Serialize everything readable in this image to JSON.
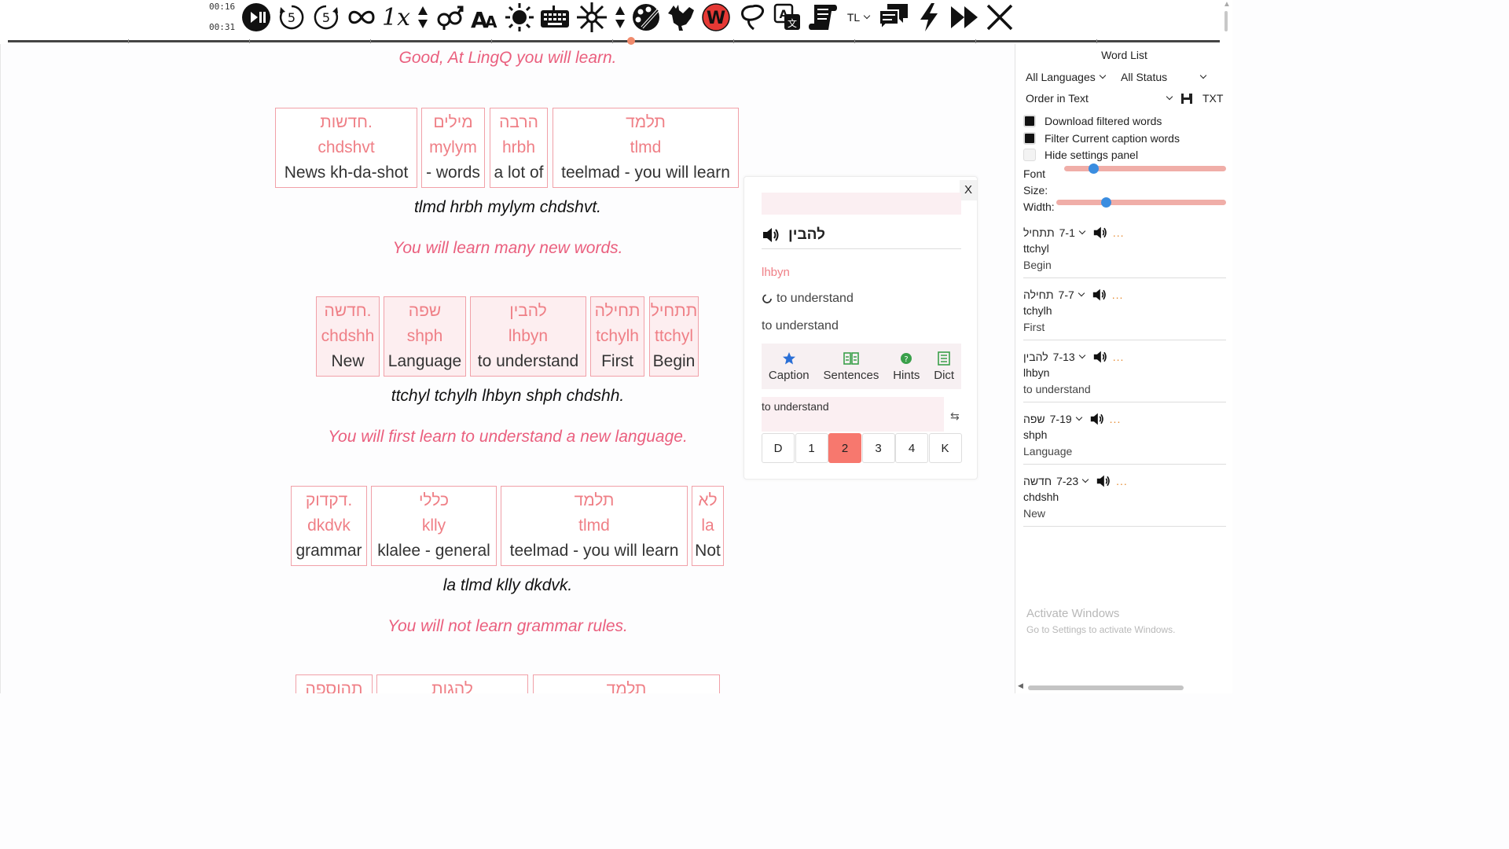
{
  "player": {
    "time_current": "00:16",
    "time_total": "00:31",
    "speed_label": "1x",
    "lang_label": "TL"
  },
  "icons": {
    "play_pause": "play-pause-icon",
    "rewind5": "rewind-5-icon",
    "forward5": "forward-5-icon",
    "loop": "loop-infinity-icon",
    "speed": "speed-icon",
    "gender": "gender-icon",
    "font": "font-size-icon",
    "brightness": "sun-icon",
    "keyboard": "keyboard-icon",
    "spark": "spark-icon",
    "palette": "palette-icon",
    "rooster": "rooster-icon",
    "word": "w-icon",
    "lasso": "lasso-icon",
    "translate": "translate-icon",
    "scroll": "scroll-icon",
    "comments": "comments-icon",
    "bolt": "bolt-icon",
    "fast_forward": "fast-forward-icon",
    "close": "close-icon"
  },
  "colors": {
    "accent_pink": "#ea5f7e",
    "card_border": "#f1a0a8",
    "active_level": "#f7786e",
    "slider_knob": "#3a8de0",
    "w_icon_bg": "#e53935"
  },
  "reader": {
    "sentences": [
      {
        "translation_top": "Good, At LingQ you will learn.",
        "cards": [
          {
            "heb": "חדשות.",
            "lat": "chdshvt",
            "eng": "News kh-da-shot"
          },
          {
            "heb": "מילים",
            "lat": "mylym",
            "eng": "- words"
          },
          {
            "heb": "הרבה",
            "lat": "hrbh",
            "eng": "a lot of"
          },
          {
            "heb": "תלמד",
            "lat": "tlmd",
            "eng": "teelmad - you will learn"
          }
        ],
        "translit": "tlmd hrbh mylym chdshvt.",
        "translation": "You will learn many new words."
      },
      {
        "cards": [
          {
            "heb": "חדשה.",
            "lat": "chdshh",
            "eng": "New"
          },
          {
            "heb": "שפה",
            "lat": "shph",
            "eng": "Language"
          },
          {
            "heb": "להבין",
            "lat": "lhbyn",
            "eng": "to understand"
          },
          {
            "heb": "תחילה",
            "lat": "tchylh",
            "eng": "First"
          },
          {
            "heb": "תתחיל",
            "lat": "ttchyl",
            "eng": "Begin"
          }
        ],
        "translit": "ttchyl tchylh lhbyn shph chdshh.",
        "translation": "You will first learn to understand a new language."
      },
      {
        "cards": [
          {
            "heb": "דקדוק.",
            "lat": "dkdvk",
            "eng": "grammar"
          },
          {
            "heb": "כללי",
            "lat": "klly",
            "eng": "klalee - general"
          },
          {
            "heb": "תלמד",
            "lat": "tlmd",
            "eng": "teelmad - you will learn"
          },
          {
            "heb": "לא",
            "lat": "la",
            "eng": "Not"
          }
        ],
        "translit": "la tlmd klly dkdvk.",
        "translation": "You will not learn grammar rules."
      },
      {
        "cards": [
          {
            "heb": "תהוספה"
          },
          {
            "heb": "להגות"
          },
          {
            "heb": "תלמד"
          }
        ]
      }
    ]
  },
  "popup": {
    "close_label": "X",
    "search_value": "",
    "word": "להבין",
    "translit": "lhbyn",
    "meaning_primary": "to understand",
    "meaning_secondary": "to understand",
    "tabs": [
      {
        "label": "Caption",
        "icon": "star-icon"
      },
      {
        "label": "Sentences",
        "icon": "sentences-icon"
      },
      {
        "label": "Hints",
        "icon": "hints-icon"
      },
      {
        "label": "Dict",
        "icon": "dict-icon"
      }
    ],
    "note_value": "to understand",
    "swap_label": "⇆",
    "levels": [
      "D",
      "1",
      "2",
      "3",
      "4",
      "K"
    ],
    "active_level": "2"
  },
  "wordlist": {
    "title": "Word List",
    "language_filter": "All Languages",
    "status_filter": "All Status",
    "order": "Order in Text",
    "export_label": "TXT",
    "checks": [
      {
        "label": "Download filtered words",
        "checked": true
      },
      {
        "label": "Filter Current caption words",
        "checked": true
      },
      {
        "label": "Hide settings panel",
        "checked": false
      }
    ],
    "font_label": "Font",
    "size_label": "Size:",
    "width_label": "Width:",
    "font_size_level": 0.18,
    "width_level": 0.29,
    "entries": [
      {
        "heb": "תתחיל",
        "ref": "7-1",
        "lat": "ttchyl",
        "meaning": "Begin",
        "more": "..."
      },
      {
        "heb": "תחילה",
        "ref": "7-7",
        "lat": "tchylh",
        "meaning": "First",
        "more": "..."
      },
      {
        "heb": "להבין",
        "ref": "7-13",
        "lat": "lhbyn",
        "meaning": "to understand",
        "more": "..."
      },
      {
        "heb": "שפה",
        "ref": "7-19",
        "lat": "shph",
        "meaning": "Language",
        "more": "..."
      },
      {
        "heb": "חדשה",
        "ref": "7-23",
        "lat": "chdshh",
        "meaning": "New",
        "more": "..."
      }
    ]
  },
  "os_overlay": {
    "line1": "Activate Windows",
    "line2": "Go to Settings to activate Windows."
  }
}
